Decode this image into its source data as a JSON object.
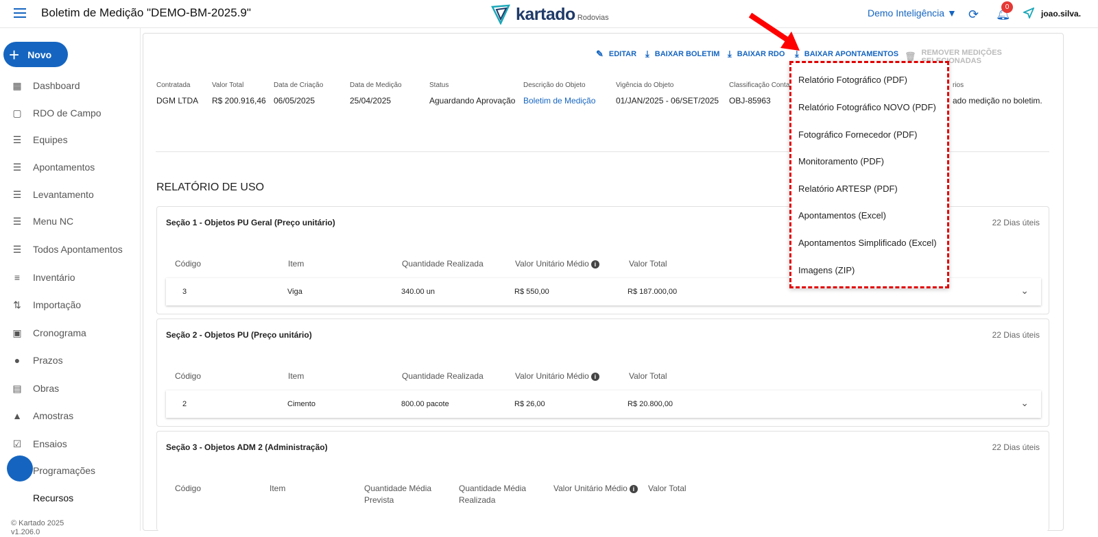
{
  "header": {
    "title": "Boletim de Medição \"DEMO-BM-2025.9\"",
    "logo_word": "kartado",
    "logo_sub": "Rodovias",
    "org": "Demo Inteligência ▼",
    "notif_count": "0",
    "user": "joao.silva."
  },
  "sidebar": {
    "new_label": "Novo",
    "items": [
      {
        "label": "Dashboard",
        "icon": "dashboard-icon"
      },
      {
        "label": "RDO de Campo",
        "icon": "clipboard-icon"
      },
      {
        "label": "Equipes",
        "icon": "list-icon"
      },
      {
        "label": "Apontamentos",
        "icon": "list-icon"
      },
      {
        "label": "Levantamento",
        "icon": "list-icon"
      },
      {
        "label": "Menu NC",
        "icon": "list-icon"
      },
      {
        "label": "Todos Apontamentos",
        "icon": "list-icon"
      },
      {
        "label": "Inventário",
        "icon": "inventory-icon"
      },
      {
        "label": "Importação",
        "icon": "import-icon"
      },
      {
        "label": "Cronograma",
        "icon": "calendar-icon"
      },
      {
        "label": "Prazos",
        "icon": "clock-icon"
      },
      {
        "label": "Obras",
        "icon": "assignment-icon"
      },
      {
        "label": "Amostras",
        "icon": "flask-icon"
      },
      {
        "label": "Ensaios",
        "icon": "checklist-icon"
      },
      {
        "label": "Programações",
        "icon": "schedule-icon"
      },
      {
        "label": "Recursos",
        "icon": "resource-icon"
      }
    ],
    "version_line1": "© Kartado 2025",
    "version_line2": "v1.206.0"
  },
  "actions": {
    "edit": "EDITAR",
    "download_boletim": "BAIXAR BOLETIM",
    "download_rdo": "BAIXAR RDO",
    "download_apontamentos": "BAIXAR APONTAMENTOS",
    "remove": "REMOVER MEDIÇÕES SELECIONADAS"
  },
  "info": [
    {
      "label": "Contratada",
      "value": "DGM LTDA"
    },
    {
      "label": "Valor Total",
      "value": "R$ 200.916,46"
    },
    {
      "label": "Data de Criação",
      "value": "06/05/2025"
    },
    {
      "label": "Data de Medição",
      "value": "25/04/2025"
    },
    {
      "label": "Status",
      "value": "Aguardando Aprovação"
    },
    {
      "label": "Descrição do Objeto",
      "value": "Boletim de Medição"
    },
    {
      "label": "Vigência do Objeto",
      "value": "01/JAN/2025 - 06/SET/2025"
    },
    {
      "label": "Classificação Conta",
      "value": "OBJ-85963"
    },
    {
      "label": "rios",
      "value": "ado medição no boletim."
    }
  ],
  "report_title": "RELATÓRIO DE USO",
  "sections": [
    {
      "title": "Seção 1 - Objetos PU Geral (Preço unitário)",
      "days": "22 Dias úteis",
      "headers": [
        "Código",
        "Item",
        "Quantidade Realizada",
        "Valor Unitário Médio",
        "Valor Total"
      ],
      "row": [
        "3",
        "Viga",
        "340.00 un",
        "R$ 550,00",
        "R$ 187.000,00"
      ]
    },
    {
      "title": "Seção 2 - Objetos PU (Preço unitário)",
      "days": "22 Dias úteis",
      "headers": [
        "Código",
        "Item",
        "Quantidade Realizada",
        "Valor Unitário Médio",
        "Valor Total"
      ],
      "row": [
        "2",
        "Cimento",
        "800.00 pacote",
        "R$ 26,00",
        "R$ 20.800,00"
      ]
    },
    {
      "title": "Seção 3 - Objetos ADM 2 (Administração)",
      "days": "22 Dias úteis",
      "headers": [
        "Código",
        "Item",
        "Quantidade Média Prevista",
        "Quantidade Média Realizada",
        "Valor Unitário Médio",
        "Valor Total"
      ]
    }
  ],
  "dropdown": [
    "Relatório Fotográfico (PDF)",
    "Relatório Fotográfico NOVO (PDF)",
    "Fotográfico Fornecedor (PDF)",
    "Monitoramento (PDF)",
    "Relatório ARTESP (PDF)",
    "Apontamentos (Excel)",
    "Apontamentos Simplificado (Excel)",
    "Imagens (ZIP)"
  ]
}
